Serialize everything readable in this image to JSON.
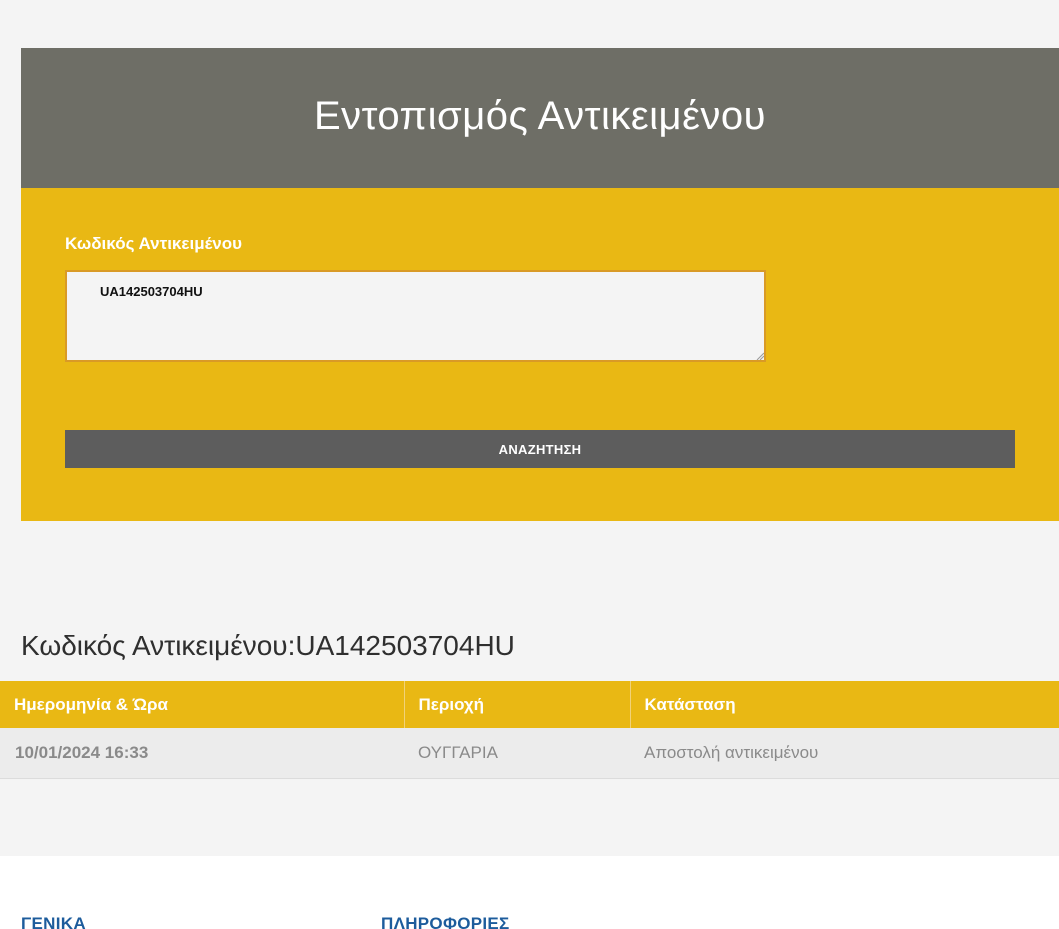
{
  "header": {
    "title": "Εντοπισμός Αντικειμένου"
  },
  "form": {
    "label": "Κωδικός Αντικειμένου",
    "code_value": "UA142503704HU",
    "search_label": "ΑΝΑΖΗΤΗΣΗ"
  },
  "result": {
    "heading": "Κωδικός Αντικειμένου:UA142503704HU",
    "columns": [
      "Ημερομηνία & Ώρα",
      "Περιοχή",
      "Κατάσταση"
    ],
    "rows": [
      {
        "datetime": "10/01/2024 16:33",
        "area": "ΟΥΓΓΑΡΙΑ",
        "status": "Αποστολή αντικειμένου"
      }
    ]
  },
  "footer": {
    "general": "ΓΕΝΙΚΑ",
    "info": "ΠΛΗΡΟΦΟΡΙΕΣ"
  },
  "colors": {
    "header_bg": "#6e6e66",
    "accent_yellow": "#e9b814",
    "button_bg": "#5d5d5d",
    "footer_link": "#1d5c9c"
  }
}
